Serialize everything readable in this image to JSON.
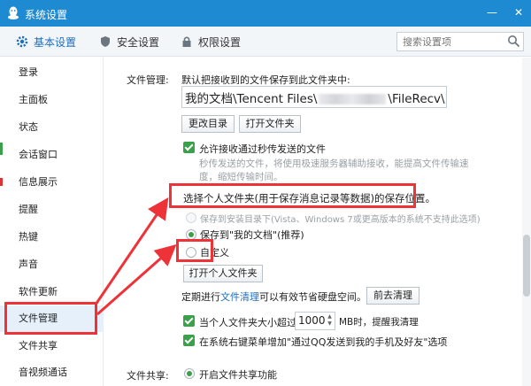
{
  "window": {
    "title": "系统设置"
  },
  "tabs": [
    {
      "label": "基本设置",
      "icon": "gear-icon"
    },
    {
      "label": "安全设置",
      "icon": "shield-icon"
    },
    {
      "label": "权限设置",
      "icon": "lock-icon"
    }
  ],
  "search": {
    "placeholder": "搜索设置项"
  },
  "sidebar": {
    "items": [
      "登录",
      "主面板",
      "状态",
      "会话窗口",
      "信息展示",
      "提醒",
      "热键",
      "声音",
      "软件更新",
      "文件管理",
      "文件共享",
      "音视频通话"
    ],
    "active": "文件管理"
  },
  "file_mgmt": {
    "section_label": "文件管理:",
    "desc": "默认把接收到的文件保存到此文件夹中:",
    "path_start": "我的文档\\Tencent Files\\",
    "path_end": "\\FileRecv\\",
    "change_dir": "更改目录",
    "open_folder": "打开文件夹",
    "allow_instant": "允许接收通过秒传发送的文件",
    "instant_desc1": "秒传发送的文件，将使用极速服务器辅助接收，能提高文件传输速",
    "instant_desc2": "度，缩短传输时间。",
    "personal_title": "选择个人文件夹(用于保存消息记录等数据)的保存位置。",
    "opt_install": "保存到安装目录下(Vista、Windows 7或更高版本的系统不支持此选项)",
    "opt_mydocs": "保存到\"我的文档\"(推荐)",
    "opt_custom": "自定义",
    "open_personal": "打开个人文件夹",
    "cleanup_pre": "定期进行",
    "cleanup_link": "文件清理",
    "cleanup_post": "可以有效节省硬盘空间。",
    "cleanup_btn": "前去清理",
    "size_pre": "当个人文件夹大小超过",
    "size_value": "1000",
    "size_post": "MB时，提醒我清理",
    "context_menu": "在系统右键菜单增加\"通过QQ发送到我的手机及好友\"选项"
  },
  "file_share": {
    "section_label": "文件共享:",
    "enable": "开启文件共享功能"
  },
  "colors": {
    "titlebar": "#1e8ad2",
    "accent_green": "#3aa04a",
    "annotation_red": "#ee3338"
  }
}
